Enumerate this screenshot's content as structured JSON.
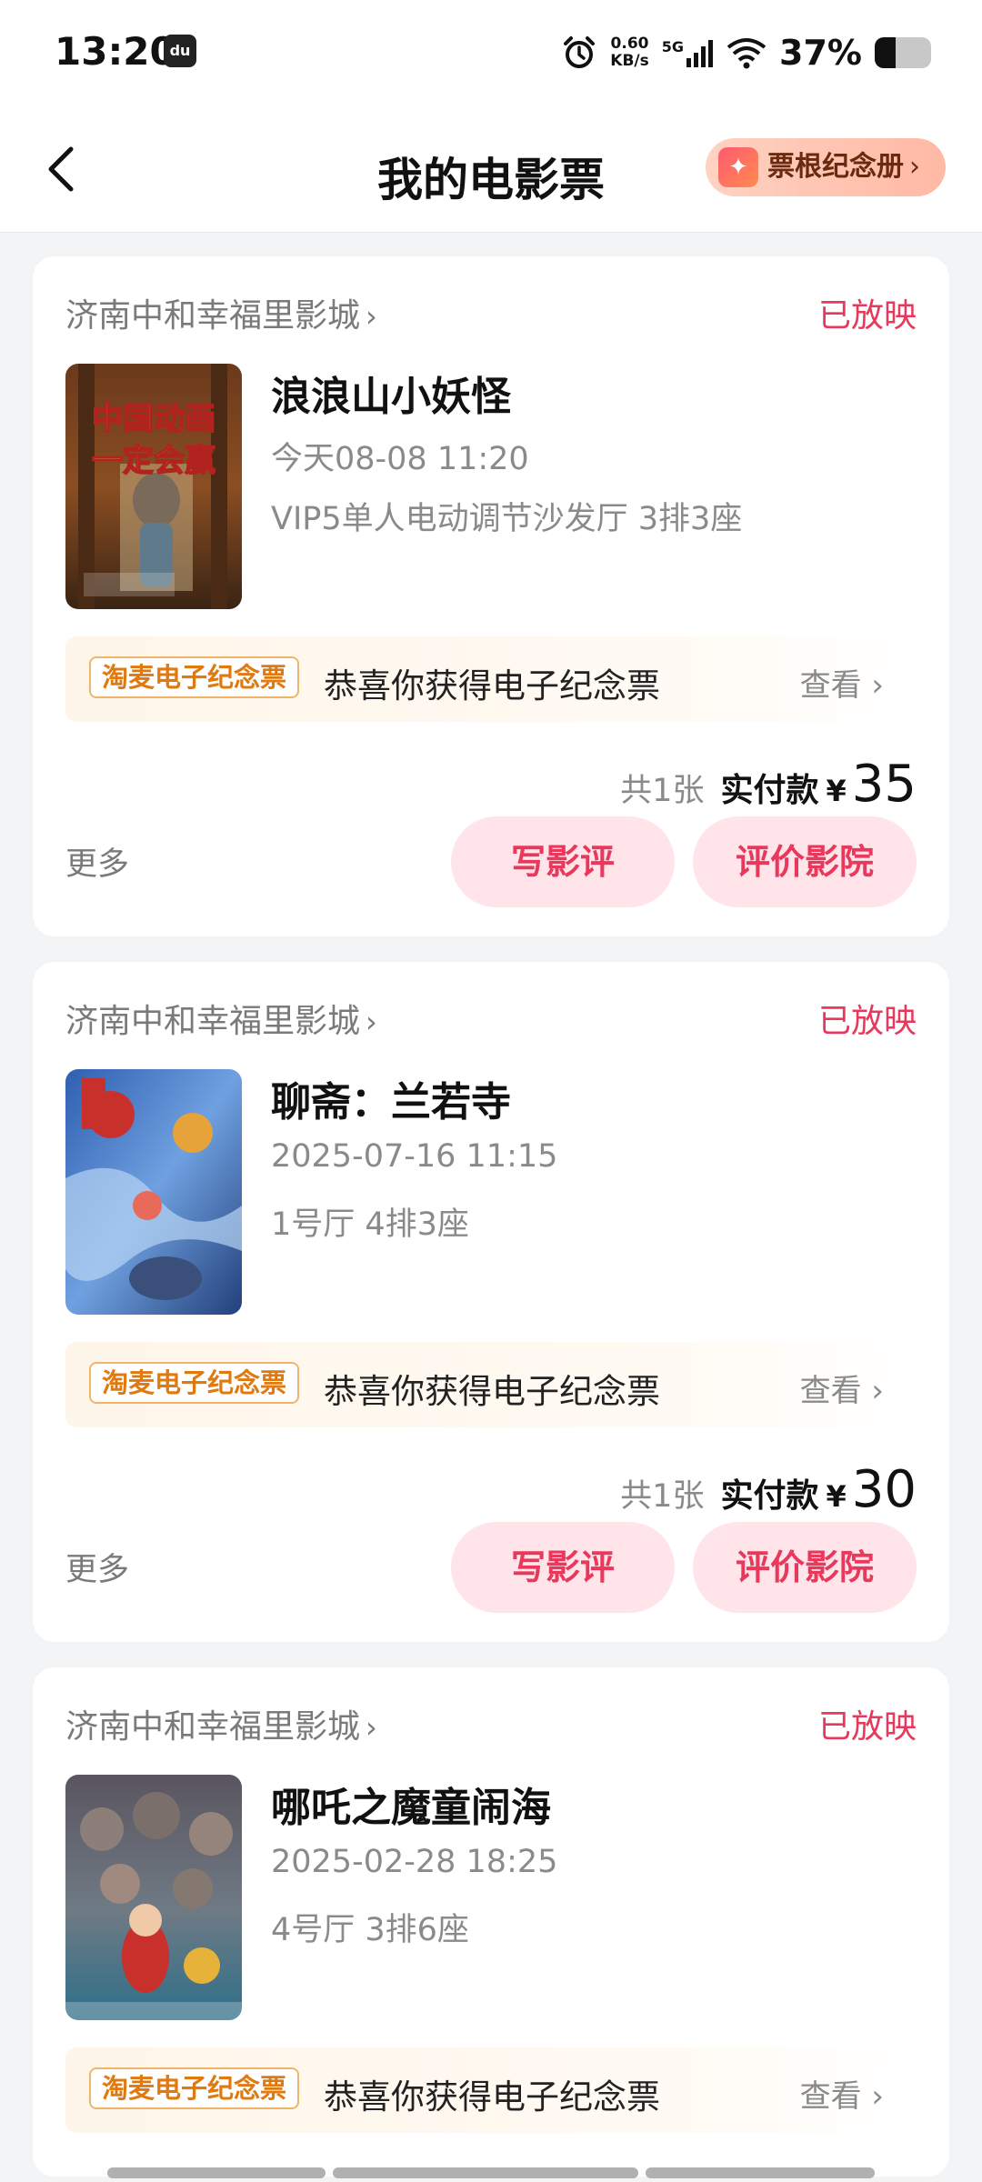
{
  "status_bar": {
    "time": "13:20",
    "app_icon_label": "du",
    "net_speed_value": "0.60",
    "net_speed_unit": "KB/s",
    "network_type": "5G",
    "battery_text": "37%",
    "battery_level": 0.37
  },
  "nav": {
    "title": "我的电影票",
    "stub_book_label": "票根纪念册",
    "back_icon": "chevron-left-icon"
  },
  "tickets": [
    {
      "cinema": "济南中和幸福里影城",
      "status": "已放映",
      "movie_title": "浪浪山小妖怪",
      "show_time": "今天08-08 11:20",
      "seat_info": "VIP5单人电动调节沙发厅 3排3座",
      "souvenir_tag": "淘麦电子纪念票",
      "souvenir_text": "恭喜你获得电子纪念票",
      "view_label": "查看",
      "quantity": "共1张",
      "paid_label": "实付款",
      "currency": "¥",
      "amount": "35",
      "more_label": "更多",
      "review_button": "写影评",
      "rate_button": "评价影院"
    },
    {
      "cinema": "济南中和幸福里影城",
      "status": "已放映",
      "movie_title": "聊斋：兰若寺",
      "show_time": "2025-07-16 11:15",
      "seat_info": "1号厅 4排3座",
      "souvenir_tag": "淘麦电子纪念票",
      "souvenir_text": "恭喜你获得电子纪念票",
      "view_label": "查看",
      "quantity": "共1张",
      "paid_label": "实付款",
      "currency": "¥",
      "amount": "30",
      "more_label": "更多",
      "review_button": "写影评",
      "rate_button": "评价影院"
    },
    {
      "cinema": "济南中和幸福里影城",
      "status": "已放映",
      "movie_title": "哪吒之魔童闹海",
      "show_time": "2025-02-28 18:25",
      "seat_info": "4号厅 3排6座",
      "souvenir_tag": "淘麦电子纪念票",
      "souvenir_text": "恭喜你获得电子纪念票",
      "view_label": "查看"
    }
  ],
  "poster_texts": {
    "poster1_headline_line1": "中国动画",
    "poster1_headline_line2": "一定会赢"
  },
  "colors": {
    "accent_red": "#e8385b",
    "button_bg": "#ffe4ea",
    "souvenir_orange": "#e07a10",
    "page_bg": "#f3f4f6"
  }
}
